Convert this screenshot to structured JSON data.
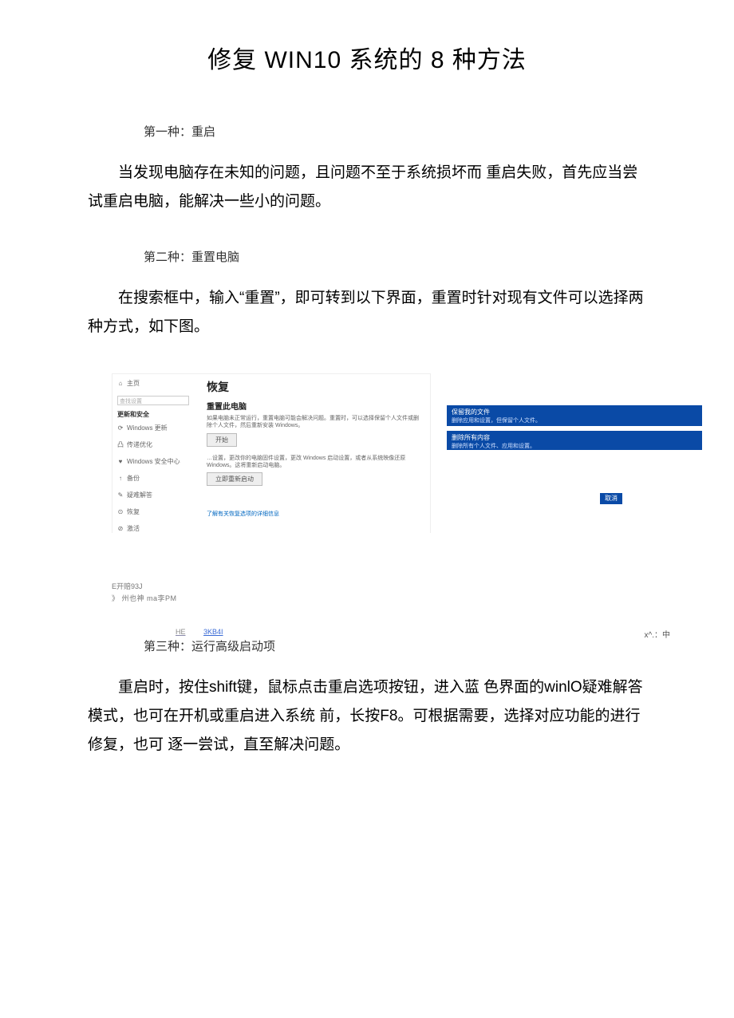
{
  "title": {
    "pre": "修复 ",
    "latin": "WIN10",
    "mid": " 系统的 ",
    "num": "8",
    "post": " 种方法"
  },
  "method1": {
    "heading": "第一种：重启",
    "body": "当发现电脑存在未知的问题，且问题不至于系统损坏而 重启失败，首先应当尝试重启电脑，能解决一些小的问题。"
  },
  "method2": {
    "heading": "第二种：重置电脑",
    "body": "在搜索框中，输入“重置”，即可转到以下界面，重置时针对现有文件可以选择两种方式，如下图。"
  },
  "screenshot": {
    "left": {
      "home": "主页",
      "search_placeholder": "查找设置",
      "cat": "更新和安全",
      "items": [
        "Windows 更新",
        "传递优化",
        "Windows 安全中心",
        "备份",
        "疑难解答",
        "恢复",
        "激活"
      ]
    },
    "right": {
      "title": "恢复",
      "subtitle": "重置此电脑",
      "desc": "如果电脑未正常运行，重置电脑可能会解决问题。重置时，可以选择保留个人文件或删除个人文件，然后重新安装 Windows。",
      "button": "开始",
      "adv_desc": "…设置，更改你的电脑固件设置，更改 Windows 启动设置，或者从系统映像还原 Windows。这将重新启动电脑。",
      "adv_btn": "立即重新启动",
      "link": "了解有关恢复选项的详细信息"
    },
    "blue1": {
      "t": "保留我的文件",
      "s": "删除应用和设置，但保留个人文件。"
    },
    "blue2": {
      "t": "删除所有内容",
      "s": "删除所有个人文件、应用和设置。"
    },
    "small_blue": "取消"
  },
  "scraps": {
    "l1": "E开赔93J",
    "l2": "》 州也神 ma李PM"
  },
  "hekb": {
    "a": "HE",
    "b": "3KB4I",
    "right": "x^.：中"
  },
  "method3": {
    "heading": "第三种：运行高级启动项",
    "body": "重启时，按住shift键，鼠标点击重启选项按钮，进入蓝 色界面的winlO疑难解答模式，也可在开机或重启进入系统 前，长按F8。可根据需要，选择对应功能的进行修复，也可 逐一尝试，直至解决问题。"
  }
}
